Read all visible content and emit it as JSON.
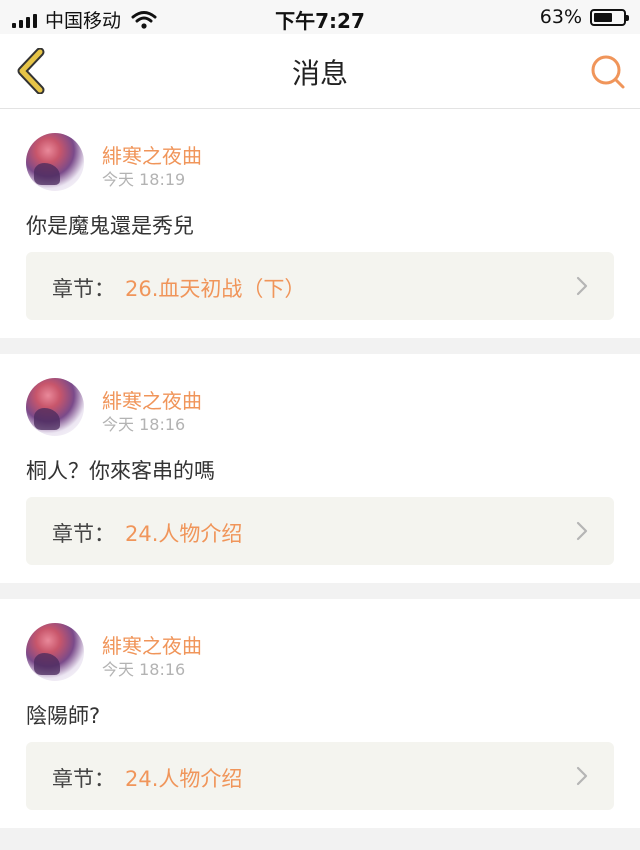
{
  "status_bar": {
    "carrier": "中国移动",
    "time": "下午7:27",
    "battery_percent": "63%",
    "battery_level": 0.63
  },
  "nav": {
    "title": "消息",
    "back_icon": "chevron-left-icon",
    "search_icon": "search-icon"
  },
  "colors": {
    "accent": "#f0955a",
    "back_icon": "#e6c447"
  },
  "messages": [
    {
      "username": "緋寒之夜曲",
      "time": "今天 18:19",
      "text": "你是魔鬼還是秀兒",
      "chapter_label": "章节：",
      "chapter_title": "26.血天初战（下）"
    },
    {
      "username": "緋寒之夜曲",
      "time": "今天 18:16",
      "text": "桐人？你來客串的嗎",
      "chapter_label": "章节：",
      "chapter_title": "24.人物介绍"
    },
    {
      "username": "緋寒之夜曲",
      "time": "今天 18:16",
      "text": "陰陽師?",
      "chapter_label": "章节：",
      "chapter_title": "24.人物介绍"
    }
  ]
}
